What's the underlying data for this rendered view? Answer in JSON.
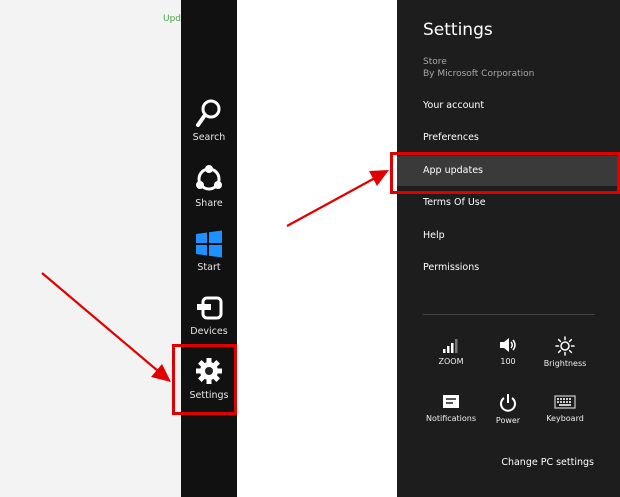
{
  "background": {
    "text": "Upd"
  },
  "charms": [
    {
      "label": "Search",
      "icon": "search-icon"
    },
    {
      "label": "Share",
      "icon": "share-icon"
    },
    {
      "label": "Start",
      "icon": "windows-logo-icon"
    },
    {
      "label": "Devices",
      "icon": "devices-icon"
    },
    {
      "label": "Settings",
      "icon": "gear-icon"
    }
  ],
  "settings_panel": {
    "title": "Settings",
    "app_name": "Store",
    "publisher": "By Microsoft Corporation",
    "items": [
      {
        "label": "Your account"
      },
      {
        "label": "Preferences"
      },
      {
        "label": "App updates"
      },
      {
        "label": "Terms Of Use"
      },
      {
        "label": "Help"
      },
      {
        "label": "Permissions"
      }
    ],
    "quick_settings": [
      {
        "label": "ZOOM",
        "icon": "network-signal-icon"
      },
      {
        "label": "100",
        "icon": "volume-icon"
      },
      {
        "label": "Brightness",
        "icon": "brightness-icon"
      },
      {
        "label": "Notifications",
        "icon": "notifications-icon"
      },
      {
        "label": "Power",
        "icon": "power-icon"
      },
      {
        "label": "Keyboard",
        "icon": "keyboard-icon"
      }
    ],
    "change_pc_settings": "Change PC settings"
  },
  "colors": {
    "annotation_red": "#e00000",
    "windows_blue": "#1e90ff",
    "panel_bg": "#1d1d1d",
    "charms_bg": "#111111"
  }
}
